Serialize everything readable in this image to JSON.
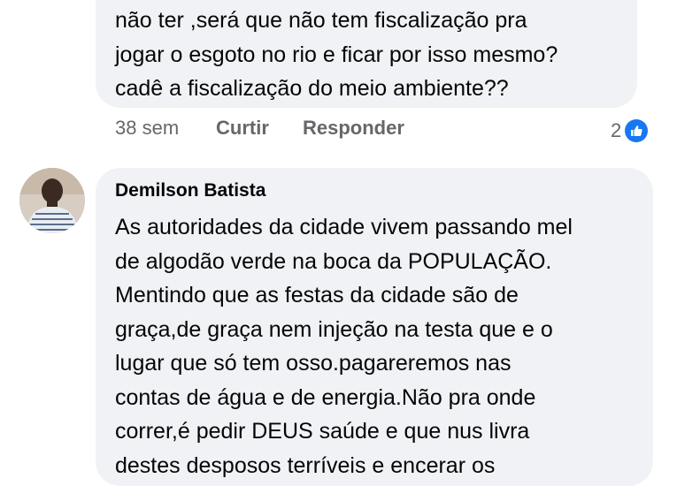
{
  "comment1": {
    "lines": [
      "não ter ,será que não tem fiscalização pra",
      "jogar o esgoto no rio e ficar por isso mesmo?",
      "cadê a fiscalização do meio ambiente??"
    ],
    "time": "38 sem",
    "like_label": "Curtir",
    "reply_label": "Responder",
    "reaction_count": "2",
    "reaction_icon": "like-icon",
    "reaction_color": "#1877f2"
  },
  "comment2": {
    "author": "Demilson Batista",
    "lines": [
      "As autoridades da cidade vivem passando mel",
      "de algodão verde na boca da POPULAÇÃO.",
      "Mentindo que as festas da cidade são de",
      "graça,de graça nem injeção na testa que e o",
      "lugar que só tem osso.pagareremos nas",
      "contas de água e de energia.Não pra onde",
      "correr,é pedir DEUS saúde e que nus livra",
      "destes desposos terríveis e encerar os"
    ]
  },
  "colors": {
    "bubble": "#f0f2f5",
    "text": "#050505",
    "secondary": "#65676b"
  }
}
